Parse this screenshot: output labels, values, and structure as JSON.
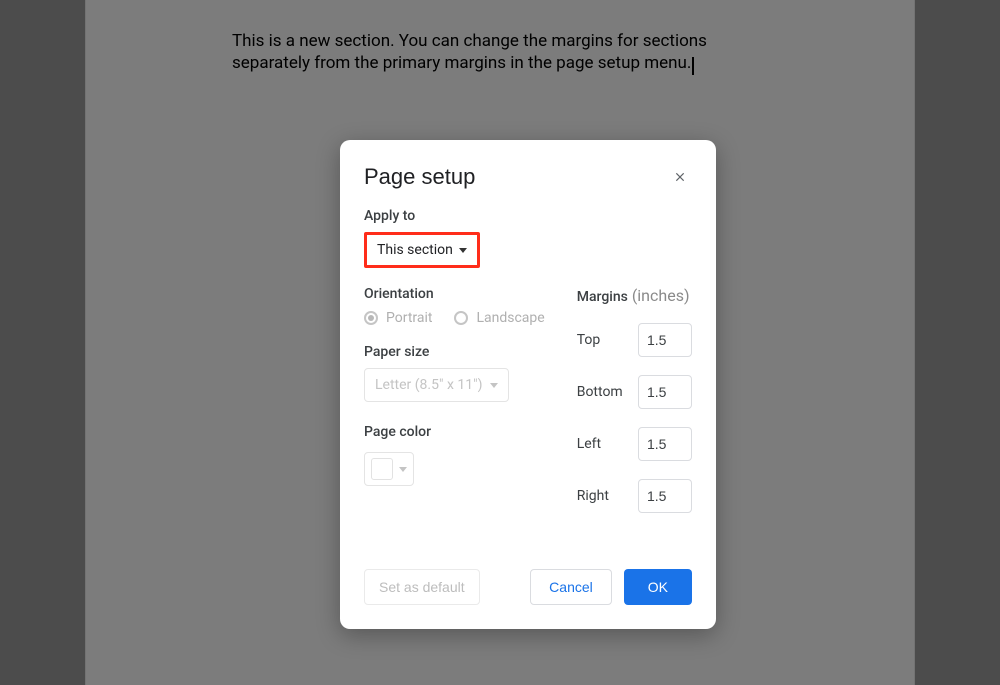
{
  "document": {
    "body_text": "This is a new section. You can change the margins for sections separately\nfrom the primary margins in the page setup menu."
  },
  "dialog": {
    "title": "Page setup",
    "apply_to": {
      "label": "Apply to",
      "value": "This section"
    },
    "orientation": {
      "label": "Orientation",
      "options": {
        "portrait": "Portrait",
        "landscape": "Landscape"
      },
      "selected": "portrait"
    },
    "paper_size": {
      "label": "Paper size",
      "value": "Letter (8.5\" x 11\")"
    },
    "page_color": {
      "label": "Page color",
      "value": "#ffffff"
    },
    "margins": {
      "label": "Margins",
      "unit": "(inches)",
      "top": {
        "label": "Top",
        "value": "1.5"
      },
      "bottom": {
        "label": "Bottom",
        "value": "1.5"
      },
      "left": {
        "label": "Left",
        "value": "1.5"
      },
      "right": {
        "label": "Right",
        "value": "1.5"
      }
    },
    "buttons": {
      "set_default": "Set as default",
      "cancel": "Cancel",
      "ok": "OK"
    }
  }
}
